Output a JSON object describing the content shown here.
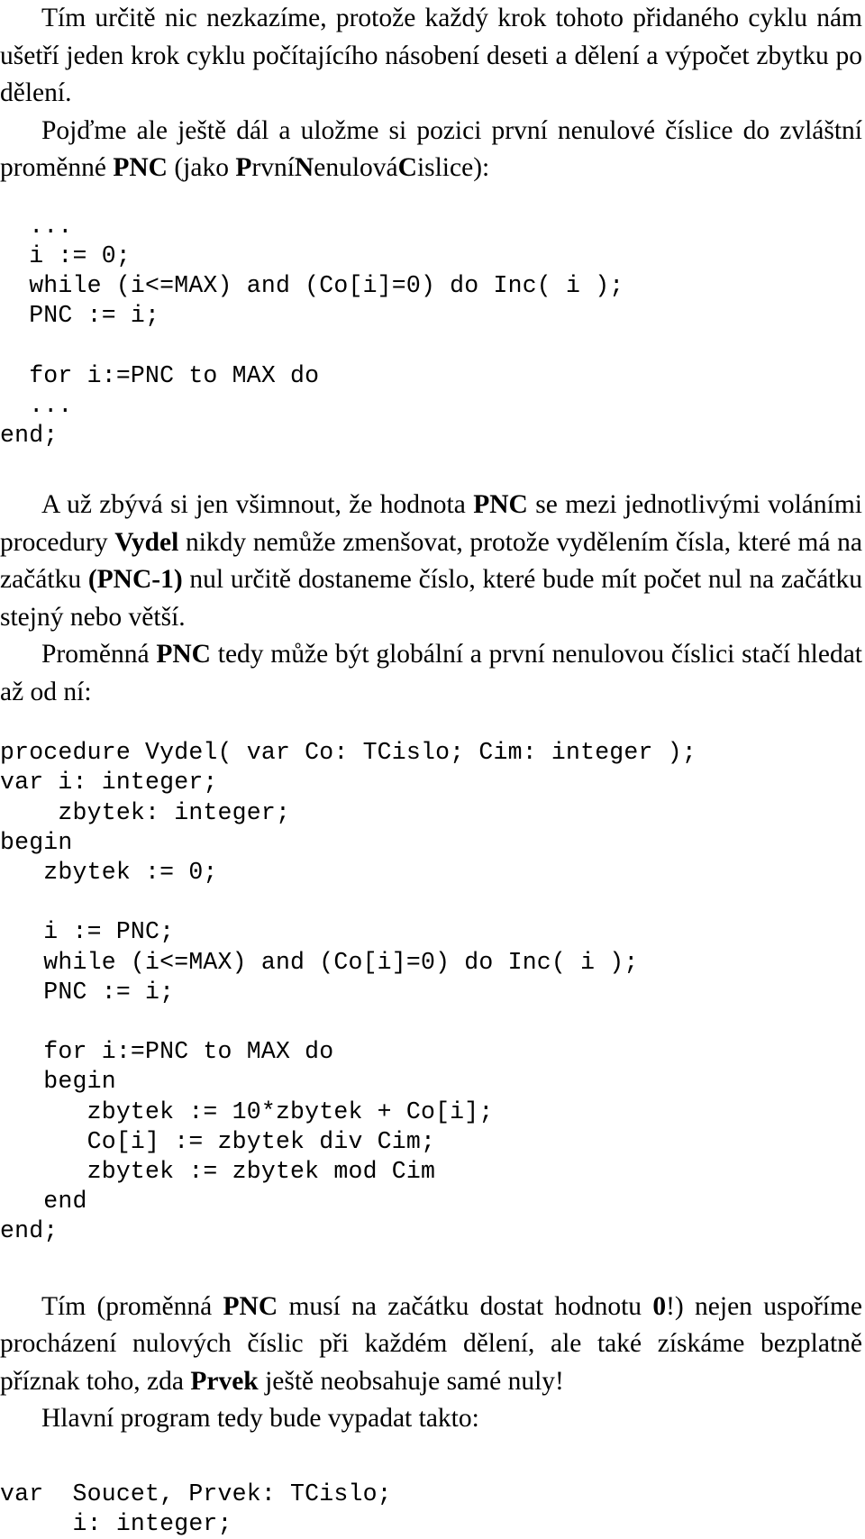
{
  "document": {
    "language": "cs",
    "kind": "textbook-page",
    "paragraphs": {
      "p1": {
        "runs": [
          {
            "text": "Tím určitě nic nezkazíme, protože každý krok tohoto přidaného cyklu nám ušetří jeden krok cyklu počítajícího násobení deseti a dělení a výpočet zbytku po dělení.",
            "bold": false
          }
        ]
      },
      "p2": {
        "runs": [
          {
            "text": "Pojďme ale ještě dál a uložme si pozici první nenulové číslice do zvláštní proměnné ",
            "bold": false
          },
          {
            "text": "PNC",
            "bold": true
          },
          {
            "text": " (jako ",
            "bold": false
          },
          {
            "text": "P",
            "bold": true
          },
          {
            "text": "rvní",
            "bold": false
          },
          {
            "text": "N",
            "bold": true
          },
          {
            "text": "enulová",
            "bold": false
          },
          {
            "text": "C",
            "bold": true
          },
          {
            "text": "islice):",
            "bold": false
          }
        ]
      },
      "p3": {
        "runs": [
          {
            "text": "A už zbývá si jen všimnout, že hodnota ",
            "bold": false
          },
          {
            "text": "PNC",
            "bold": true
          },
          {
            "text": " se mezi jednotlivými voláními procedury ",
            "bold": false
          },
          {
            "text": "Vydel",
            "bold": true
          },
          {
            "text": " nikdy nemůže zmenšovat, protože vydělením čísla, které má na začátku ",
            "bold": false
          },
          {
            "text": "(PNC-1)",
            "bold": true
          },
          {
            "text": " nul určitě dostaneme číslo, které bude mít počet nul na začátku stejný nebo větší.",
            "bold": false
          }
        ]
      },
      "p4": {
        "runs": [
          {
            "text": "Proměnná ",
            "bold": false
          },
          {
            "text": "PNC",
            "bold": true
          },
          {
            "text": " tedy může být globální a první nenulovou číslici stačí hledat až od ní:",
            "bold": false
          }
        ]
      },
      "p5": {
        "runs": [
          {
            "text": "Tím (proměnná ",
            "bold": false
          },
          {
            "text": "PNC",
            "bold": true
          },
          {
            "text": " musí na začátku dostat hodnotu ",
            "bold": false
          },
          {
            "text": "0",
            "bold": true
          },
          {
            "text": "!) nejen uspoříme procházení nulových číslic při každém dělení, ale také získáme bezplatně příznak toho, zda ",
            "bold": false
          },
          {
            "text": "Prvek",
            "bold": true
          },
          {
            "text": " ještě neobsahuje samé nuly!",
            "bold": false
          }
        ]
      },
      "p6": {
        "runs": [
          {
            "text": "Hlavní program tedy bude vypadat takto:",
            "bold": false
          }
        ]
      }
    },
    "code_blocks": {
      "block1": "  ...\n  i := 0;\n  while (i<=MAX) and (Co[i]=0) do Inc( i );\n  PNC := i;\n\n  for i:=PNC to MAX do\n  ...\nend;",
      "block2": "procedure Vydel( var Co: TCislo; Cim: integer );\nvar i: integer;\n    zbytek: integer;\nbegin\n   zbytek := 0;\n\n   i := PNC;\n   while (i<=MAX) and (Co[i]=0) do Inc( i );\n   PNC := i;\n\n   for i:=PNC to MAX do\n   begin\n      zbytek := 10*zbytek + Co[i];\n      Co[i] := zbytek div Cim;\n      zbytek := zbytek mod Cim\n   end\nend;",
      "block3": "var  Soucet, Prvek: TCislo;\n     i: integer;"
    }
  }
}
